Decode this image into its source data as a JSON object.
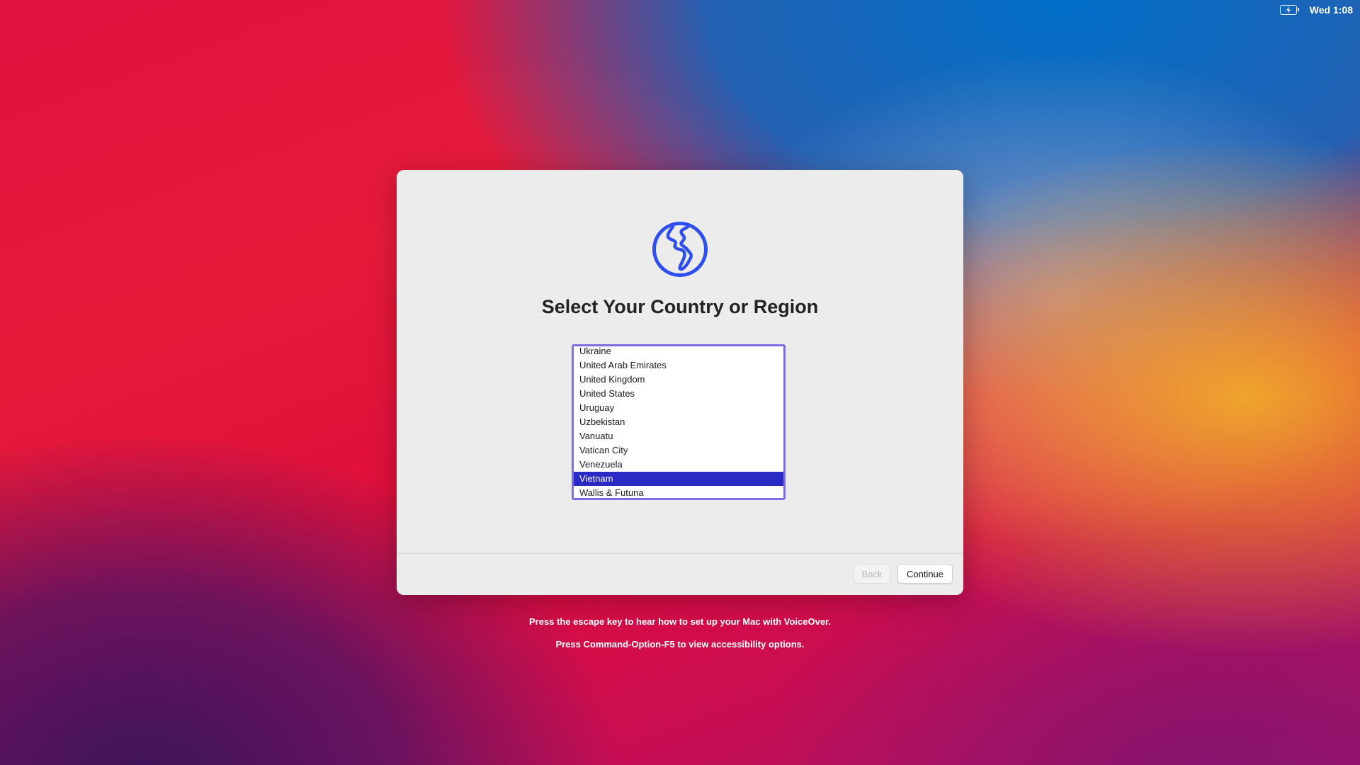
{
  "menubar": {
    "battery_icon": "battery-charging-icon",
    "clock": "Wed 1:08"
  },
  "dialog": {
    "icon": "globe-icon",
    "title": "Select Your Country or Region",
    "countries": [
      "Ukraine",
      "United Arab Emirates",
      "United Kingdom",
      "United States",
      "Uruguay",
      "Uzbekistan",
      "Vanuatu",
      "Vatican City",
      "Venezuela",
      "Vietnam",
      "Wallis & Futuna"
    ],
    "selected": "Vietnam",
    "back_label": "Back",
    "continue_label": "Continue"
  },
  "hints": {
    "voiceover": "Press the escape key to hear how to set up your Mac with VoiceOver.",
    "accessibility": "Press Command-Option-F5 to view accessibility options."
  },
  "colors": {
    "accent": "#2e4ff0",
    "selection": "#2a2bc4",
    "focus_ring": "#7b6ee0"
  }
}
